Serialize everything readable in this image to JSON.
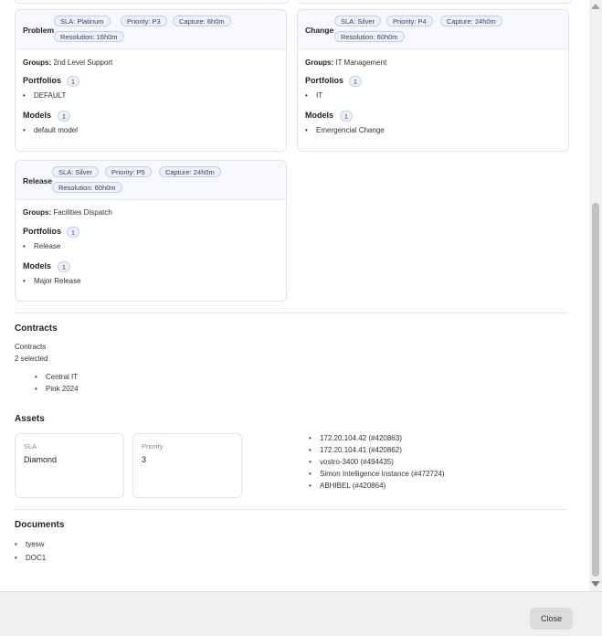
{
  "cards": [
    {
      "title": "Problem",
      "badges": [
        "SLA: Platinum",
        "Priority: P3",
        "Capture: 6h0m",
        "Resolution: 16h0m"
      ],
      "groups_label": "Groups:",
      "groups_value": "2nd Level Support",
      "portfolios_label": "Portfolios",
      "portfolios_count": "1",
      "portfolios": [
        "DEFAULT"
      ],
      "models_label": "Models",
      "models_count": "1",
      "models": [
        "default model"
      ]
    },
    {
      "title": "Change",
      "badges": [
        "SLA: Silver",
        "Priority: P4",
        "Capture: 24h0m",
        "Resolution: 60h0m"
      ],
      "groups_label": "Groups:",
      "groups_value": "IT Management",
      "portfolios_label": "Portfolios",
      "portfolios_count": "1",
      "portfolios": [
        "IT"
      ],
      "models_label": "Models",
      "models_count": "1",
      "models": [
        "Emergencial Change"
      ]
    },
    {
      "title": "Release",
      "badges": [
        "SLA: Silver",
        "Priority: P5",
        "Capture: 24h0m",
        "Resolution: 60h0m"
      ],
      "groups_label": "Groups:",
      "groups_value": "Facilities Dispatch",
      "portfolios_label": "Portfolios",
      "portfolios_count": "1",
      "portfolios": [
        "Release"
      ],
      "models_label": "Models",
      "models_count": "1",
      "models": [
        "Major Release"
      ]
    }
  ],
  "contracts": {
    "title": "Contracts",
    "field_label": "Contracts",
    "selected_text": "2 selected",
    "items": [
      "Central IT",
      "Pink 2024"
    ]
  },
  "assets": {
    "title": "Assets",
    "sla_label": "SLA",
    "sla_value": "Diamond",
    "priority_label": "Priority",
    "priority_value": "3",
    "items": [
      "172.20.104.42 (#420863)",
      "172.20.104.41 (#420862)",
      "vostro-3400 (#494435)",
      "Simon Intelligence Instance (#472724)",
      "ABHIBEL (#420864)"
    ]
  },
  "documents": {
    "title": "Documents",
    "items": [
      "tyesw",
      "DOC1"
    ]
  },
  "footer": {
    "close_label": "Close"
  }
}
